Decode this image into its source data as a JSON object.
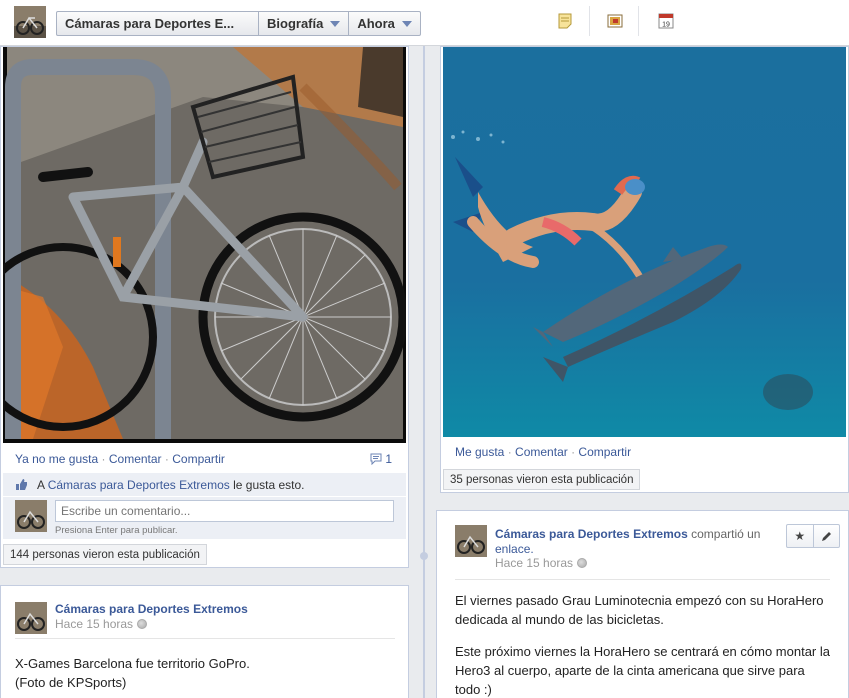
{
  "topbar": {
    "page_name": "Cámaras para Deportes E...",
    "biography": "Biografía",
    "now": "Ahora",
    "calendar_day": "19"
  },
  "left_post1": {
    "actions": {
      "unlike": "Ya no me gusta",
      "comment": "Comentar",
      "share": "Compartir",
      "comment_count": "1"
    },
    "likes": {
      "prefix": "A",
      "page": "Cámaras para Deportes Extremos",
      "suffix": "le gusta esto."
    },
    "comment_box": {
      "placeholder": "Escribe un comentario...",
      "hint": "Presiona Enter para publicar."
    },
    "views": "144 personas vieron esta publicación"
  },
  "right_post1": {
    "actions": {
      "like": "Me gusta",
      "comment": "Comentar",
      "share": "Compartir"
    },
    "views": "35 personas vieron esta publicación"
  },
  "right_post2": {
    "author": "Cámaras para Deportes Extremos",
    "shared": "compartió un",
    "link": "enlace.",
    "time": "Hace 15 horas",
    "paragraph1": "El viernes pasado Grau Luminotecnia empezó con su HoraHero dedicada al mundo de las bicicletas.",
    "paragraph2": "Este próximo viernes la HoraHero se centrará en cómo montar la Hero3 al cuerpo, aparte de la cinta americana que sirve para todo :)"
  },
  "left_post2": {
    "author": "Cámaras para Deportes Extremos",
    "time": "Hace 15 horas",
    "line1": "X-Games Barcelona fue territorio GoPro.",
    "line2": "(Foto de KPSports)"
  },
  "colors": {
    "link": "#3b5998",
    "spine": "#c4cde0",
    "ocean": "#1a6fa0"
  }
}
